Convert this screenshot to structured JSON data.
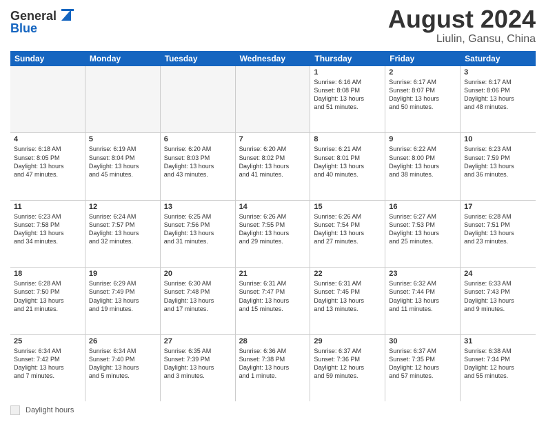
{
  "logo": {
    "line1": "General",
    "line2": "Blue"
  },
  "title": "August 2024",
  "location": "Liulin, Gansu, China",
  "days_of_week": [
    "Sunday",
    "Monday",
    "Tuesday",
    "Wednesday",
    "Thursday",
    "Friday",
    "Saturday"
  ],
  "legend_label": "Daylight hours",
  "weeks": [
    [
      {
        "day": "",
        "lines": []
      },
      {
        "day": "",
        "lines": []
      },
      {
        "day": "",
        "lines": []
      },
      {
        "day": "",
        "lines": []
      },
      {
        "day": "1",
        "lines": [
          "Sunrise: 6:16 AM",
          "Sunset: 8:08 PM",
          "Daylight: 13 hours",
          "and 51 minutes."
        ]
      },
      {
        "day": "2",
        "lines": [
          "Sunrise: 6:17 AM",
          "Sunset: 8:07 PM",
          "Daylight: 13 hours",
          "and 50 minutes."
        ]
      },
      {
        "day": "3",
        "lines": [
          "Sunrise: 6:17 AM",
          "Sunset: 8:06 PM",
          "Daylight: 13 hours",
          "and 48 minutes."
        ]
      }
    ],
    [
      {
        "day": "4",
        "lines": [
          "Sunrise: 6:18 AM",
          "Sunset: 8:05 PM",
          "Daylight: 13 hours",
          "and 47 minutes."
        ]
      },
      {
        "day": "5",
        "lines": [
          "Sunrise: 6:19 AM",
          "Sunset: 8:04 PM",
          "Daylight: 13 hours",
          "and 45 minutes."
        ]
      },
      {
        "day": "6",
        "lines": [
          "Sunrise: 6:20 AM",
          "Sunset: 8:03 PM",
          "Daylight: 13 hours",
          "and 43 minutes."
        ]
      },
      {
        "day": "7",
        "lines": [
          "Sunrise: 6:20 AM",
          "Sunset: 8:02 PM",
          "Daylight: 13 hours",
          "and 41 minutes."
        ]
      },
      {
        "day": "8",
        "lines": [
          "Sunrise: 6:21 AM",
          "Sunset: 8:01 PM",
          "Daylight: 13 hours",
          "and 40 minutes."
        ]
      },
      {
        "day": "9",
        "lines": [
          "Sunrise: 6:22 AM",
          "Sunset: 8:00 PM",
          "Daylight: 13 hours",
          "and 38 minutes."
        ]
      },
      {
        "day": "10",
        "lines": [
          "Sunrise: 6:23 AM",
          "Sunset: 7:59 PM",
          "Daylight: 13 hours",
          "and 36 minutes."
        ]
      }
    ],
    [
      {
        "day": "11",
        "lines": [
          "Sunrise: 6:23 AM",
          "Sunset: 7:58 PM",
          "Daylight: 13 hours",
          "and 34 minutes."
        ]
      },
      {
        "day": "12",
        "lines": [
          "Sunrise: 6:24 AM",
          "Sunset: 7:57 PM",
          "Daylight: 13 hours",
          "and 32 minutes."
        ]
      },
      {
        "day": "13",
        "lines": [
          "Sunrise: 6:25 AM",
          "Sunset: 7:56 PM",
          "Daylight: 13 hours",
          "and 31 minutes."
        ]
      },
      {
        "day": "14",
        "lines": [
          "Sunrise: 6:26 AM",
          "Sunset: 7:55 PM",
          "Daylight: 13 hours",
          "and 29 minutes."
        ]
      },
      {
        "day": "15",
        "lines": [
          "Sunrise: 6:26 AM",
          "Sunset: 7:54 PM",
          "Daylight: 13 hours",
          "and 27 minutes."
        ]
      },
      {
        "day": "16",
        "lines": [
          "Sunrise: 6:27 AM",
          "Sunset: 7:53 PM",
          "Daylight: 13 hours",
          "and 25 minutes."
        ]
      },
      {
        "day": "17",
        "lines": [
          "Sunrise: 6:28 AM",
          "Sunset: 7:51 PM",
          "Daylight: 13 hours",
          "and 23 minutes."
        ]
      }
    ],
    [
      {
        "day": "18",
        "lines": [
          "Sunrise: 6:28 AM",
          "Sunset: 7:50 PM",
          "Daylight: 13 hours",
          "and 21 minutes."
        ]
      },
      {
        "day": "19",
        "lines": [
          "Sunrise: 6:29 AM",
          "Sunset: 7:49 PM",
          "Daylight: 13 hours",
          "and 19 minutes."
        ]
      },
      {
        "day": "20",
        "lines": [
          "Sunrise: 6:30 AM",
          "Sunset: 7:48 PM",
          "Daylight: 13 hours",
          "and 17 minutes."
        ]
      },
      {
        "day": "21",
        "lines": [
          "Sunrise: 6:31 AM",
          "Sunset: 7:47 PM",
          "Daylight: 13 hours",
          "and 15 minutes."
        ]
      },
      {
        "day": "22",
        "lines": [
          "Sunrise: 6:31 AM",
          "Sunset: 7:45 PM",
          "Daylight: 13 hours",
          "and 13 minutes."
        ]
      },
      {
        "day": "23",
        "lines": [
          "Sunrise: 6:32 AM",
          "Sunset: 7:44 PM",
          "Daylight: 13 hours",
          "and 11 minutes."
        ]
      },
      {
        "day": "24",
        "lines": [
          "Sunrise: 6:33 AM",
          "Sunset: 7:43 PM",
          "Daylight: 13 hours",
          "and 9 minutes."
        ]
      }
    ],
    [
      {
        "day": "25",
        "lines": [
          "Sunrise: 6:34 AM",
          "Sunset: 7:42 PM",
          "Daylight: 13 hours",
          "and 7 minutes."
        ]
      },
      {
        "day": "26",
        "lines": [
          "Sunrise: 6:34 AM",
          "Sunset: 7:40 PM",
          "Daylight: 13 hours",
          "and 5 minutes."
        ]
      },
      {
        "day": "27",
        "lines": [
          "Sunrise: 6:35 AM",
          "Sunset: 7:39 PM",
          "Daylight: 13 hours",
          "and 3 minutes."
        ]
      },
      {
        "day": "28",
        "lines": [
          "Sunrise: 6:36 AM",
          "Sunset: 7:38 PM",
          "Daylight: 13 hours",
          "and 1 minute."
        ]
      },
      {
        "day": "29",
        "lines": [
          "Sunrise: 6:37 AM",
          "Sunset: 7:36 PM",
          "Daylight: 12 hours",
          "and 59 minutes."
        ]
      },
      {
        "day": "30",
        "lines": [
          "Sunrise: 6:37 AM",
          "Sunset: 7:35 PM",
          "Daylight: 12 hours",
          "and 57 minutes."
        ]
      },
      {
        "day": "31",
        "lines": [
          "Sunrise: 6:38 AM",
          "Sunset: 7:34 PM",
          "Daylight: 12 hours",
          "and 55 minutes."
        ]
      }
    ]
  ]
}
